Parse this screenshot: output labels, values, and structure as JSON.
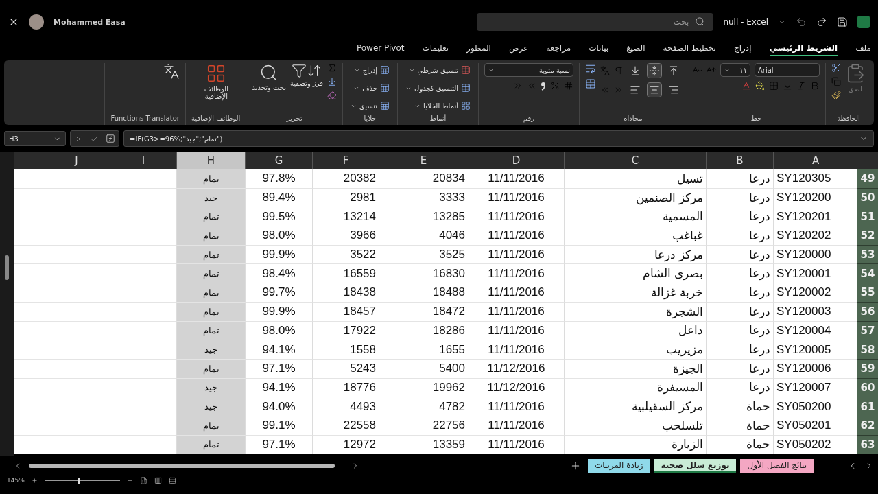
{
  "title_bar": {
    "user": "Mohammed Easa",
    "search": {
      "placeholder": "بحث"
    },
    "title": "null - Excel"
  },
  "tabs": [
    {
      "label": "ملف",
      "selected": false
    },
    {
      "label": "الشريط الرئيسي",
      "selected": true
    },
    {
      "label": "إدراج",
      "selected": false
    },
    {
      "label": "تخطيط الصفحة",
      "selected": false
    },
    {
      "label": "الصيغ",
      "selected": false
    },
    {
      "label": "بيانات",
      "selected": false
    },
    {
      "label": "مراجعة",
      "selected": false
    },
    {
      "label": "عرض",
      "selected": false
    },
    {
      "label": "المطور",
      "selected": false
    },
    {
      "label": "تعليمات",
      "selected": false
    },
    {
      "label": "Power Pivot",
      "selected": false
    }
  ],
  "ribbon": {
    "groups": [
      {
        "kind": "clipboard",
        "label": "الحافظة",
        "paste": {
          "label": "لصق",
          "disabled": true
        }
      },
      {
        "kind": "font",
        "label": "خط",
        "font_name": "Arial",
        "font_size": "١١"
      },
      {
        "kind": "alignment",
        "label": "محاذاة",
        "buttons": [
          {
            "kind": "top",
            "selected": false
          },
          {
            "kind": "middle",
            "selected": true
          },
          {
            "kind": "bottom",
            "selected": false
          },
          {
            "kind": "right",
            "selected": false
          },
          {
            "kind": "center",
            "selected": true
          },
          {
            "kind": "left",
            "selected": false
          }
        ]
      },
      {
        "kind": "number",
        "label": "رقم",
        "format": "نسبة مئوية"
      },
      {
        "kind": "styles",
        "label": "أنماط",
        "buttons": [
          "تنسيق شرطي",
          "التنسيق كجدول",
          "أنماط الخلايا"
        ]
      },
      {
        "kind": "cells",
        "label": "خلايا",
        "buttons": [
          "إدراج",
          "حذف",
          "تنسيق"
        ]
      },
      {
        "kind": "editing",
        "label": "تحرير",
        "buttons": [
          "فرز وتصفية",
          "بحث وتحديد"
        ]
      },
      {
        "kind": "addins",
        "label": "الوظائف الإضافية",
        "button": "الوظائف الإضافية"
      },
      {
        "kind": "translator",
        "label": "Functions Translator"
      }
    ]
  },
  "formula_bar": {
    "name_box": "H3",
    "formula": "=IF(G3>=96%;\"تمام\";\"جيد\")"
  },
  "columns": [
    {
      "label": "A",
      "selected": false
    },
    {
      "label": "B",
      "selected": false
    },
    {
      "label": "C",
      "selected": false
    },
    {
      "label": "D",
      "selected": false
    },
    {
      "label": "E",
      "selected": false
    },
    {
      "label": "F",
      "selected": false
    },
    {
      "label": "G",
      "selected": false
    },
    {
      "label": "H",
      "selected": true
    },
    {
      "label": "I",
      "selected": false
    },
    {
      "label": "J",
      "selected": false
    }
  ],
  "rows": [
    {
      "number": "49",
      "cells": [
        "SY120305",
        "درعا",
        "تسيل",
        "11/11/2016",
        "20834",
        "20382",
        "97.8%",
        "تمام"
      ]
    },
    {
      "number": "50",
      "cells": [
        "SY120200",
        "درعا",
        "مركز الصنمين",
        "11/11/2016",
        "3333",
        "2981",
        "89.4%",
        "جيد"
      ]
    },
    {
      "number": "51",
      "cells": [
        "SY120201",
        "درعا",
        "المسمية",
        "11/11/2016",
        "13285",
        "13214",
        "99.5%",
        "تمام"
      ]
    },
    {
      "number": "52",
      "cells": [
        "SY120202",
        "درعا",
        "غباغب",
        "11/11/2016",
        "4046",
        "3966",
        "98.0%",
        "تمام"
      ]
    },
    {
      "number": "53",
      "cells": [
        "SY120000",
        "درعا",
        "مركز درعا",
        "11/11/2016",
        "3525",
        "3522",
        "99.9%",
        "تمام"
      ]
    },
    {
      "number": "54",
      "cells": [
        "SY120001",
        "درعا",
        "بصرى الشام",
        "11/11/2016",
        "16830",
        "16559",
        "98.4%",
        "تمام"
      ]
    },
    {
      "number": "55",
      "cells": [
        "SY120002",
        "درعا",
        "خربة غزالة",
        "11/11/2016",
        "18488",
        "18438",
        "99.7%",
        "تمام"
      ]
    },
    {
      "number": "56",
      "cells": [
        "SY120003",
        "درعا",
        "الشجرة",
        "11/11/2016",
        "18472",
        "18457",
        "99.9%",
        "تمام"
      ]
    },
    {
      "number": "57",
      "cells": [
        "SY120004",
        "درعا",
        "داعل",
        "11/11/2016",
        "18286",
        "17922",
        "98.0%",
        "تمام"
      ]
    },
    {
      "number": "58",
      "cells": [
        "SY120005",
        "درعا",
        "مزيريب",
        "11/11/2016",
        "1655",
        "1558",
        "94.1%",
        "جيد"
      ]
    },
    {
      "number": "59",
      "cells": [
        "SY120006",
        "درعا",
        "الجيزة",
        "11/12/2016",
        "5400",
        "5243",
        "97.1%",
        "تمام"
      ]
    },
    {
      "number": "60",
      "cells": [
        "SY120007",
        "درعا",
        "المسيفرة",
        "11/12/2016",
        "19962",
        "18776",
        "94.1%",
        "جيد"
      ]
    },
    {
      "number": "61",
      "cells": [
        "SY050200",
        "حماة",
        "مركز السقيلبية",
        "11/11/2016",
        "4782",
        "4493",
        "94.0%",
        "جيد"
      ]
    },
    {
      "number": "62",
      "cells": [
        "SY050201",
        "حماة",
        "تلسلحب",
        "11/11/2016",
        "22756",
        "22558",
        "99.1%",
        "تمام"
      ]
    },
    {
      "number": "63",
      "cells": [
        "SY050202",
        "حماة",
        "الزيارة",
        "11/11/2016",
        "13359",
        "12972",
        "97.1%",
        "تمام"
      ]
    }
  ],
  "sheets": [
    {
      "label": "نتائج الفصل الأول",
      "selected": false,
      "color": "#f4a7c3"
    },
    {
      "label": "توزيع سلل صحية",
      "selected": true,
      "color": "#c9ecd6"
    },
    {
      "label": "زيادة المرتبات",
      "selected": false,
      "color": "#8fd9ea"
    }
  ],
  "status_bar": {
    "zoom": "145%",
    "zoom_slider": {
      "level": 0.45
    }
  }
}
